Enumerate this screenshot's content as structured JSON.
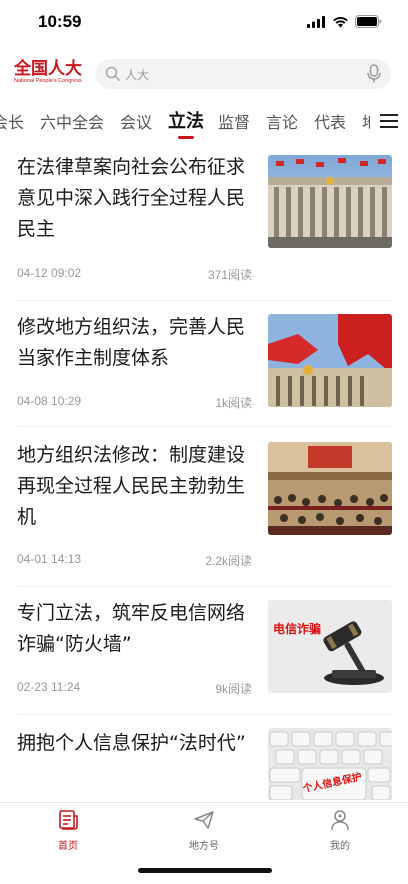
{
  "status_bar": {
    "time": "10:59"
  },
  "header": {
    "logo_cn": "全国人大",
    "logo_en": "National People's Congress",
    "search_placeholder": "人大"
  },
  "tabs": [
    {
      "label": "会长"
    },
    {
      "label": "六中全会"
    },
    {
      "label": "会议"
    },
    {
      "label": "立法",
      "active": true
    },
    {
      "label": "监督"
    },
    {
      "label": "言论"
    },
    {
      "label": "代表"
    },
    {
      "label": "地方"
    }
  ],
  "articles": [
    {
      "title": "在法律草案向社会公布征求意见中深入践行全过程人民民主",
      "date": "04-12 09:02",
      "reads": "371阅读"
    },
    {
      "title": "修改地方组织法，完善人民当家作主制度体系",
      "date": "04-08 10:29",
      "reads": "1k阅读"
    },
    {
      "title": "地方组织法修改：制度建设再现全过程人民民主勃勃生机",
      "date": "04-01 14:13",
      "reads": "2.2k阅读"
    },
    {
      "title": "专门立法，筑牢反电信网络诈骗“防火墙”",
      "date": "02-23 11:24",
      "reads": "9k阅读",
      "thumb_text": "电信诈骗"
    },
    {
      "title": "拥抱个人信息保护“法时代”",
      "thumb_text": "个人信息保护"
    }
  ],
  "bottom_nav": [
    {
      "label": "首页",
      "icon": "news-icon",
      "active": true
    },
    {
      "label": "地方号",
      "icon": "paper-plane-icon"
    },
    {
      "label": "我的",
      "icon": "user-icon"
    }
  ],
  "colors": {
    "accent": "#c8161d",
    "text": "#1a1a1a",
    "muted": "#999999"
  }
}
